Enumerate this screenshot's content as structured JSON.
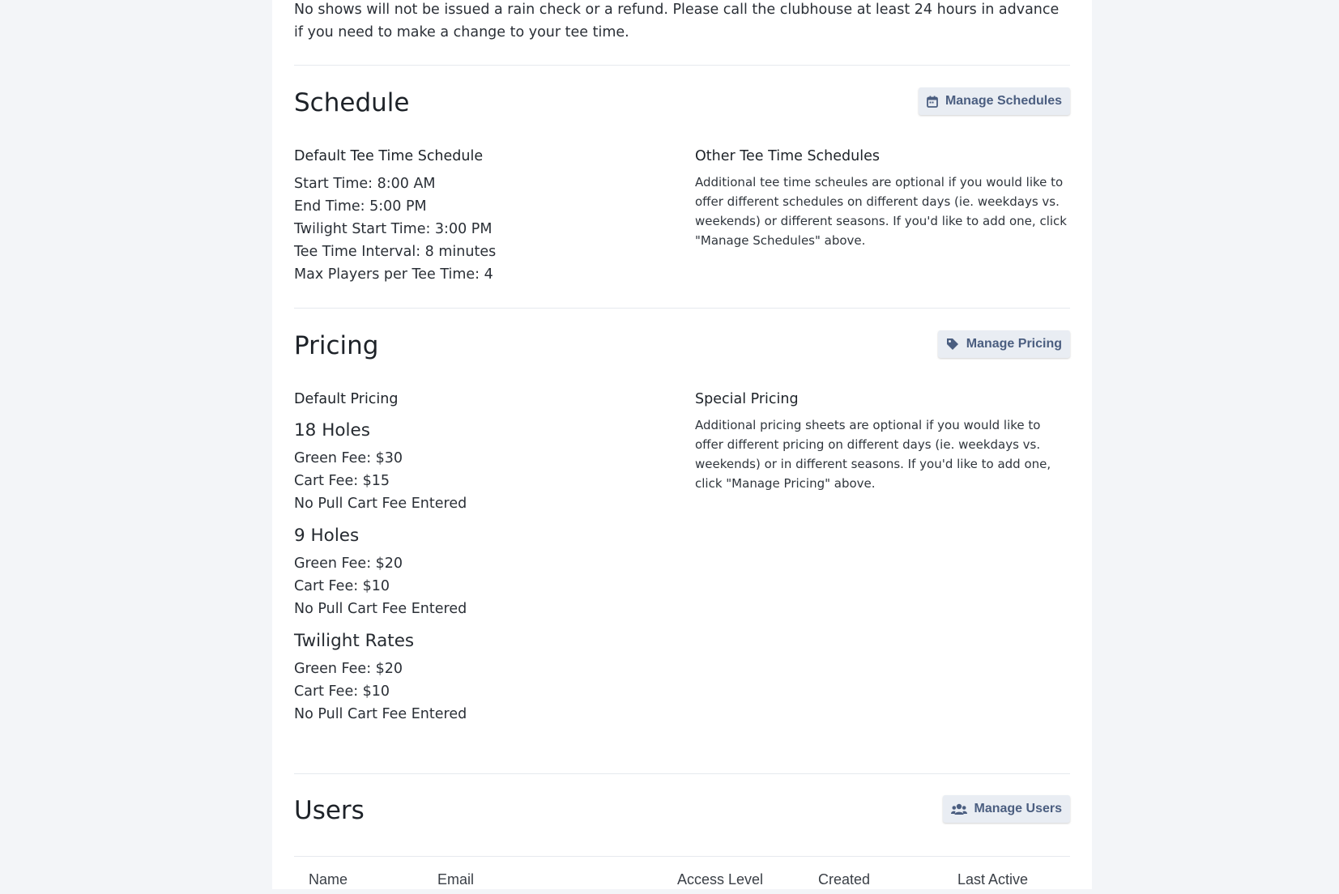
{
  "policy_text": "No shows will not be issued a rain check or a refund. Please call the clubhouse at least 24 hours in advance if you need to make a change to your tee time.",
  "schedule": {
    "title": "Schedule",
    "manage_button": "Manage Schedules",
    "default": {
      "heading": "Default Tee Time Schedule",
      "lines": [
        "Start Time: 8:00 AM",
        "End Time: 5:00 PM",
        "Twilight Start Time: 3:00 PM",
        "Tee Time Interval: 8 minutes",
        "Max Players per Tee Time: 4"
      ]
    },
    "other": {
      "heading": "Other Tee Time Schedules",
      "description": "Additional tee time scheules are optional if you would like to offer different schedules on different days (ie. weekdays vs. weekends) or different seasons. If you'd like to add one, click \"Manage Schedules\" above."
    }
  },
  "pricing": {
    "title": "Pricing",
    "manage_button": "Manage Pricing",
    "default": {
      "heading": "Default Pricing",
      "groups": [
        {
          "title": "18 Holes",
          "lines": [
            "Green Fee: $30",
            "Cart Fee: $15",
            "No Pull Cart Fee Entered"
          ]
        },
        {
          "title": "9 Holes",
          "lines": [
            "Green Fee: $20",
            "Cart Fee: $10",
            "No Pull Cart Fee Entered"
          ]
        },
        {
          "title": "Twilight Rates",
          "lines": [
            "Green Fee: $20",
            "Cart Fee: $10",
            "No Pull Cart Fee Entered"
          ]
        }
      ]
    },
    "special": {
      "heading": "Special Pricing",
      "description": "Additional pricing sheets are optional if you would like to offer different pricing on different days (ie. weekdays vs. weekends) or in different seasons. If you'd like to add one, click \"Manage Pricing\" above."
    }
  },
  "users": {
    "title": "Users",
    "manage_button": "Manage Users",
    "columns": [
      "Name",
      "Email",
      "Access Level",
      "Created",
      "Last Active"
    ]
  },
  "icons": {
    "schedule": "calendar-icon",
    "pricing": "tag-icon",
    "users": "users-icon"
  },
  "colors": {
    "page_bg": "#f3f5f8",
    "card_bg": "#ffffff",
    "button_bg": "#e9edf3",
    "button_text": "#4b5e80",
    "divider": "#e6e9ee"
  }
}
